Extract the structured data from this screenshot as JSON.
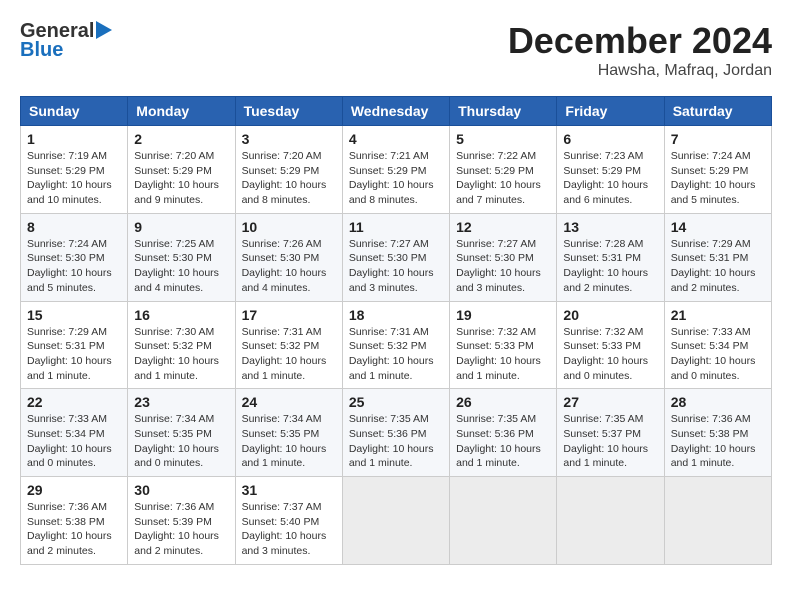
{
  "header": {
    "logo_general": "General",
    "logo_blue": "Blue",
    "month_title": "December 2024",
    "location": "Hawsha, Mafraq, Jordan"
  },
  "calendar": {
    "days_of_week": [
      "Sunday",
      "Monday",
      "Tuesday",
      "Wednesday",
      "Thursday",
      "Friday",
      "Saturday"
    ],
    "weeks": [
      [
        {
          "day": "1",
          "info": "Sunrise: 7:19 AM\nSunset: 5:29 PM\nDaylight: 10 hours\nand 10 minutes."
        },
        {
          "day": "2",
          "info": "Sunrise: 7:20 AM\nSunset: 5:29 PM\nDaylight: 10 hours\nand 9 minutes."
        },
        {
          "day": "3",
          "info": "Sunrise: 7:20 AM\nSunset: 5:29 PM\nDaylight: 10 hours\nand 8 minutes."
        },
        {
          "day": "4",
          "info": "Sunrise: 7:21 AM\nSunset: 5:29 PM\nDaylight: 10 hours\nand 8 minutes."
        },
        {
          "day": "5",
          "info": "Sunrise: 7:22 AM\nSunset: 5:29 PM\nDaylight: 10 hours\nand 7 minutes."
        },
        {
          "day": "6",
          "info": "Sunrise: 7:23 AM\nSunset: 5:29 PM\nDaylight: 10 hours\nand 6 minutes."
        },
        {
          "day": "7",
          "info": "Sunrise: 7:24 AM\nSunset: 5:29 PM\nDaylight: 10 hours\nand 5 minutes."
        }
      ],
      [
        {
          "day": "8",
          "info": "Sunrise: 7:24 AM\nSunset: 5:30 PM\nDaylight: 10 hours\nand 5 minutes."
        },
        {
          "day": "9",
          "info": "Sunrise: 7:25 AM\nSunset: 5:30 PM\nDaylight: 10 hours\nand 4 minutes."
        },
        {
          "day": "10",
          "info": "Sunrise: 7:26 AM\nSunset: 5:30 PM\nDaylight: 10 hours\nand 4 minutes."
        },
        {
          "day": "11",
          "info": "Sunrise: 7:27 AM\nSunset: 5:30 PM\nDaylight: 10 hours\nand 3 minutes."
        },
        {
          "day": "12",
          "info": "Sunrise: 7:27 AM\nSunset: 5:30 PM\nDaylight: 10 hours\nand 3 minutes."
        },
        {
          "day": "13",
          "info": "Sunrise: 7:28 AM\nSunset: 5:31 PM\nDaylight: 10 hours\nand 2 minutes."
        },
        {
          "day": "14",
          "info": "Sunrise: 7:29 AM\nSunset: 5:31 PM\nDaylight: 10 hours\nand 2 minutes."
        }
      ],
      [
        {
          "day": "15",
          "info": "Sunrise: 7:29 AM\nSunset: 5:31 PM\nDaylight: 10 hours\nand 1 minute."
        },
        {
          "day": "16",
          "info": "Sunrise: 7:30 AM\nSunset: 5:32 PM\nDaylight: 10 hours\nand 1 minute."
        },
        {
          "day": "17",
          "info": "Sunrise: 7:31 AM\nSunset: 5:32 PM\nDaylight: 10 hours\nand 1 minute."
        },
        {
          "day": "18",
          "info": "Sunrise: 7:31 AM\nSunset: 5:32 PM\nDaylight: 10 hours\nand 1 minute."
        },
        {
          "day": "19",
          "info": "Sunrise: 7:32 AM\nSunset: 5:33 PM\nDaylight: 10 hours\nand 1 minute."
        },
        {
          "day": "20",
          "info": "Sunrise: 7:32 AM\nSunset: 5:33 PM\nDaylight: 10 hours\nand 0 minutes."
        },
        {
          "day": "21",
          "info": "Sunrise: 7:33 AM\nSunset: 5:34 PM\nDaylight: 10 hours\nand 0 minutes."
        }
      ],
      [
        {
          "day": "22",
          "info": "Sunrise: 7:33 AM\nSunset: 5:34 PM\nDaylight: 10 hours\nand 0 minutes."
        },
        {
          "day": "23",
          "info": "Sunrise: 7:34 AM\nSunset: 5:35 PM\nDaylight: 10 hours\nand 0 minutes."
        },
        {
          "day": "24",
          "info": "Sunrise: 7:34 AM\nSunset: 5:35 PM\nDaylight: 10 hours\nand 1 minute."
        },
        {
          "day": "25",
          "info": "Sunrise: 7:35 AM\nSunset: 5:36 PM\nDaylight: 10 hours\nand 1 minute."
        },
        {
          "day": "26",
          "info": "Sunrise: 7:35 AM\nSunset: 5:36 PM\nDaylight: 10 hours\nand 1 minute."
        },
        {
          "day": "27",
          "info": "Sunrise: 7:35 AM\nSunset: 5:37 PM\nDaylight: 10 hours\nand 1 minute."
        },
        {
          "day": "28",
          "info": "Sunrise: 7:36 AM\nSunset: 5:38 PM\nDaylight: 10 hours\nand 1 minute."
        }
      ],
      [
        {
          "day": "29",
          "info": "Sunrise: 7:36 AM\nSunset: 5:38 PM\nDaylight: 10 hours\nand 2 minutes."
        },
        {
          "day": "30",
          "info": "Sunrise: 7:36 AM\nSunset: 5:39 PM\nDaylight: 10 hours\nand 2 minutes."
        },
        {
          "day": "31",
          "info": "Sunrise: 7:37 AM\nSunset: 5:40 PM\nDaylight: 10 hours\nand 3 minutes."
        },
        {
          "day": "",
          "info": ""
        },
        {
          "day": "",
          "info": ""
        },
        {
          "day": "",
          "info": ""
        },
        {
          "day": "",
          "info": ""
        }
      ]
    ]
  }
}
